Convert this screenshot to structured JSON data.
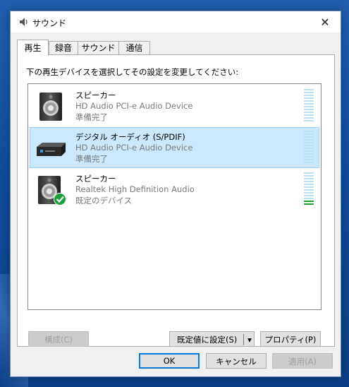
{
  "dialog": {
    "title": "サウンド",
    "close_label": "✕"
  },
  "tabs": [
    {
      "label": "再生",
      "active": true
    },
    {
      "label": "録音",
      "active": false
    },
    {
      "label": "サウンド",
      "active": false
    },
    {
      "label": "通信",
      "active": false
    }
  ],
  "playback": {
    "instruction": "下の再生デバイスを選択してその設定を変更してください:",
    "devices": [
      {
        "name": "スピーカー",
        "driver": "HD Audio PCI-e Audio Device",
        "status": "準備完了",
        "icon": "speaker-icon",
        "selected": false,
        "level": 0
      },
      {
        "name": "デジタル オーディオ (S/PDIF)",
        "driver": "HD Audio PCI-e Audio Device",
        "status": "準備完了",
        "icon": "spdif-device-icon",
        "selected": true,
        "level": 0
      },
      {
        "name": "スピーカー",
        "driver": "Realtek High Definition Audio",
        "status": "既定のデバイス",
        "icon": "speaker-default-icon",
        "selected": false,
        "level": 0.2
      }
    ]
  },
  "buttons": {
    "configure": "構成(C)",
    "set_default": "既定値に設定(S)",
    "set_default_arrow": "▾",
    "properties": "プロパティ(P)",
    "ok": "OK",
    "cancel": "キャンセル",
    "apply": "適用(A)"
  },
  "colors": {
    "selection": "#cce8ff",
    "selection_border": "#99d1ff",
    "meter_idle": "#b9e4ee",
    "meter_active": "#1fa133",
    "default_check": "#1b9d3c",
    "accent": "#0078d7"
  }
}
